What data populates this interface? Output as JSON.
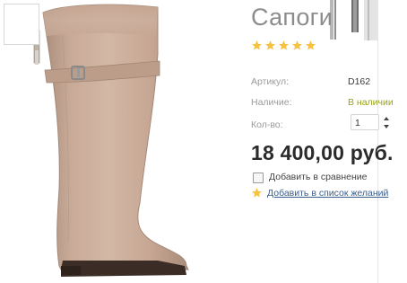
{
  "product": {
    "title": "Сапоги",
    "rating_stars": 5,
    "rating_max": 5,
    "article_label": "Артикул:",
    "article_value": "D162",
    "availability_label": "Наличие:",
    "availability_value": "В наличии",
    "quantity_label": "Кол-во:",
    "quantity_value": "1",
    "price": "18 400,00 руб.",
    "compare_label": "Добавить в сравнение",
    "wishlist_label": "Добавить в список желаний"
  },
  "colors": {
    "star": "#f5c242",
    "availability": "#9aa31c",
    "link": "#3b5f8a",
    "boot": "#c9aa98"
  },
  "icons": {
    "rating": "star-icon",
    "wishlist": "star-icon",
    "stepper_up": "caret-up-icon",
    "stepper_down": "caret-down-icon"
  }
}
